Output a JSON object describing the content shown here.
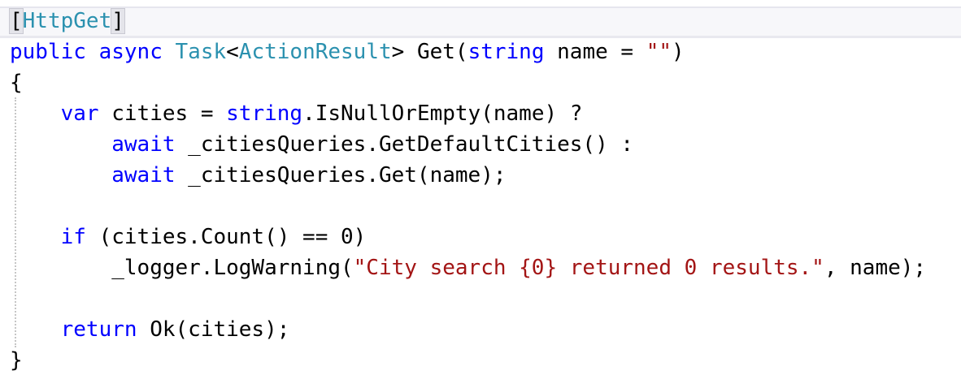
{
  "colors": {
    "keyword": "#0000ff",
    "type": "#2b91af",
    "string": "#a31515",
    "plain": "#000000",
    "background": "#ffffff"
  },
  "code": {
    "l1": {
      "open": "[",
      "attr": "HttpGet",
      "close": "]"
    },
    "l2": {
      "public": "public",
      "sp1": " ",
      "async": "async",
      "sp2": " ",
      "task": "Task",
      "lt": "<",
      "actionresult": "ActionResult",
      "gt_get": "> Get(",
      "string": "string",
      "name_eq": " name = ",
      "empty": "\"\"",
      "close": ")"
    },
    "l3": {
      "brace": "{"
    },
    "l4": {
      "indent": "    ",
      "var": "var",
      "mid": " cities = ",
      "string": "string",
      "rest": ".IsNullOrEmpty(name) ?"
    },
    "l5": {
      "indent": "        ",
      "await": "await",
      "rest": " _citiesQueries.GetDefaultCities() :"
    },
    "l6": {
      "indent": "        ",
      "await": "await",
      "rest": " _citiesQueries.Get(name);"
    },
    "l8": {
      "indent": "    ",
      "if": "if",
      "rest": " (cities.Count() == 0)"
    },
    "l9": {
      "indent": "        ",
      "pre": "_logger.LogWarning(",
      "str": "\"City search {0} returned 0 results.\"",
      "post": ", name);"
    },
    "l11": {
      "indent": "    ",
      "return": "return",
      "rest": " Ok(cities);"
    },
    "l12": {
      "brace": "}"
    }
  }
}
